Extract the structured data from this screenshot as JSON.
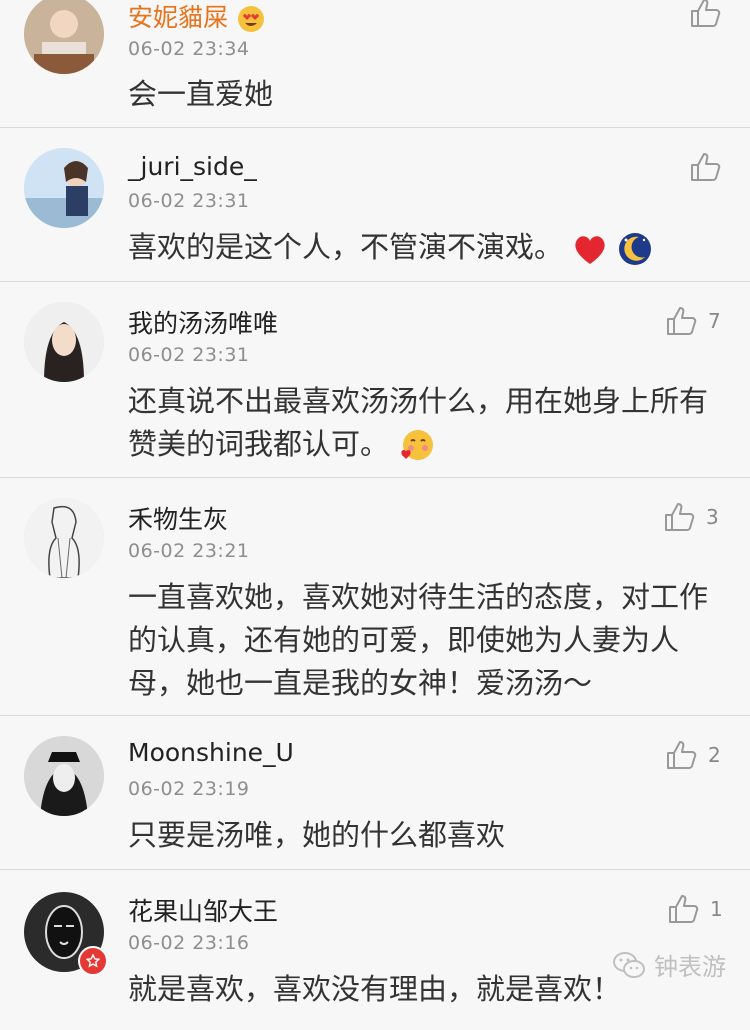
{
  "comments": [
    {
      "name": "安妮貓屎",
      "time": "06-02 23:34",
      "text": "会一直爱她",
      "likes": ""
    },
    {
      "name": "_juri_side_",
      "time": "06-02 23:31",
      "text": "喜欢的是这个人，不管演不演戏。",
      "likes": ""
    },
    {
      "name": "我的汤汤唯唯",
      "time": "06-02 23:31",
      "text": "还真说不出最喜欢汤汤什么，用在她身上所有赞美的词我都认可。",
      "likes": "7"
    },
    {
      "name": "禾物生灰",
      "time": "06-02 23:21",
      "text": "一直喜欢她，喜欢她对待生活的态度，对工作的认真，还有她的可爱，即使她为人妻为人母，她也一直是我的女神！爱汤汤～",
      "likes": "3"
    },
    {
      "name": "Moonshine_U",
      "time": "06-02 23:19",
      "text": "只要是汤唯，她的什么都喜欢",
      "likes": "2"
    },
    {
      "name": "花果山邹大王",
      "time": "06-02 23:16",
      "text": "就是喜欢，喜欢没有理由，就是喜欢！",
      "likes": "1"
    }
  ],
  "watermark": {
    "text": "钟表游",
    "icon": "wechat-icon"
  },
  "colors": {
    "name_highlight": "#e8731a",
    "time": "#8e8e8e",
    "divider": "#d9d9d9",
    "background": "#f7f7f7"
  }
}
